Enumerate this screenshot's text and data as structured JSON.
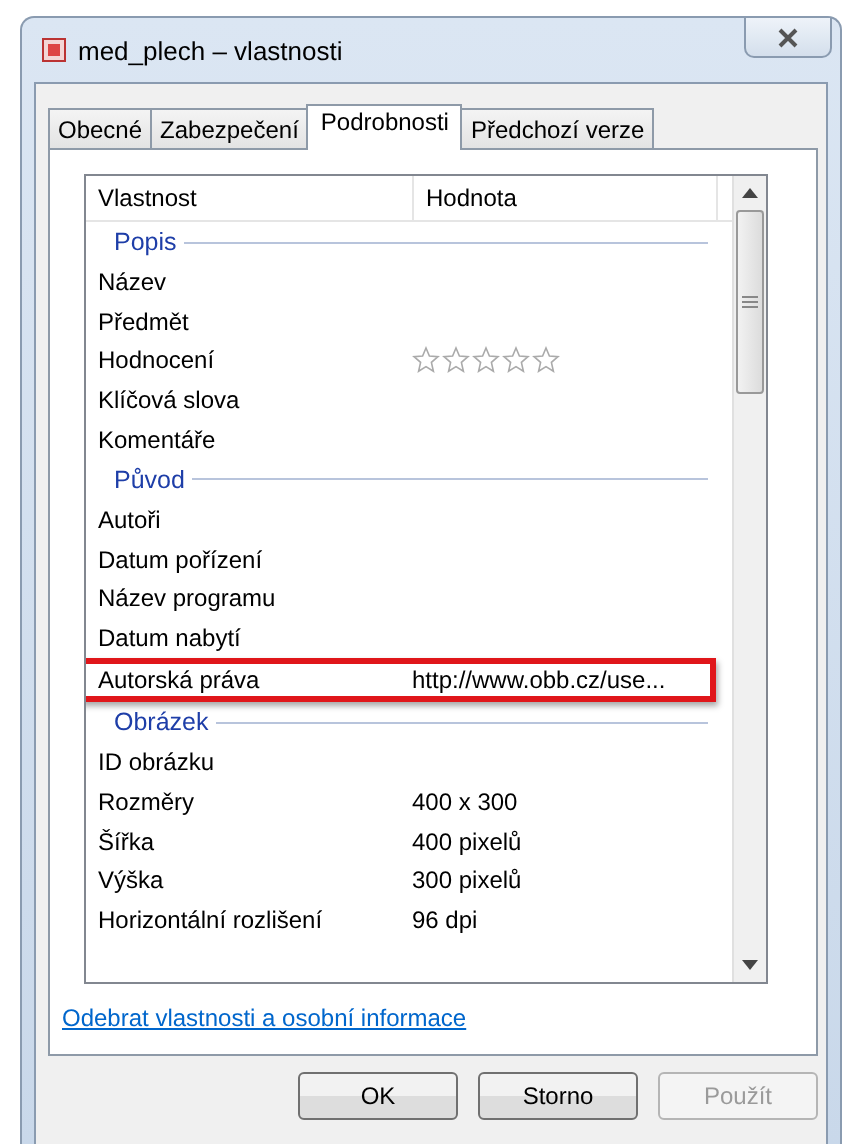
{
  "window": {
    "title": "med_plech – vlastnosti"
  },
  "tabs": [
    {
      "label": "Obecné",
      "selected": false
    },
    {
      "label": "Zabezpečení",
      "selected": false
    },
    {
      "label": "Podrobnosti",
      "selected": true
    },
    {
      "label": "Předchozí verze",
      "selected": false
    }
  ],
  "table": {
    "columns": [
      "Vlastnost",
      "Hodnota"
    ],
    "groups": [
      {
        "title": "Popis",
        "rows": [
          {
            "kind": "text",
            "name": "Název",
            "highlighted": false
          },
          {
            "kind": "text",
            "name": "Předmět",
            "highlighted": false
          },
          {
            "kind": "rating",
            "name": "Hodnocení",
            "stars": 0,
            "highlighted": false
          },
          {
            "kind": "text",
            "name": "Klíčová slova",
            "highlighted": false
          },
          {
            "kind": "text",
            "name": "Komentáře",
            "highlighted": false
          }
        ]
      },
      {
        "title": "Původ",
        "rows": [
          {
            "kind": "text",
            "name": "Autoři",
            "highlighted": false
          },
          {
            "kind": "text",
            "name": "Datum pořízení",
            "highlighted": false
          },
          {
            "kind": "text",
            "name": "Název programu",
            "highlighted": false
          },
          {
            "kind": "text",
            "name": "Datum nabytí",
            "highlighted": false
          },
          {
            "kind": "text",
            "name": "Autorská práva",
            "value": "http://www.obb.cz/use...",
            "highlighted": true
          }
        ]
      },
      {
        "title": "Obrázek",
        "rows": [
          {
            "kind": "text",
            "name": "ID obrázku",
            "highlighted": false
          },
          {
            "kind": "text",
            "name": "Rozměry",
            "value": "400 x 300",
            "highlighted": false
          },
          {
            "kind": "text",
            "name": "Šířka",
            "value": "400 pixelů",
            "highlighted": false
          },
          {
            "kind": "text",
            "name": "Výška",
            "value": "300 pixelů",
            "highlighted": false
          },
          {
            "kind": "text",
            "name": "Horizontální rozlišení",
            "value": "96 dpi",
            "highlighted": false
          }
        ]
      }
    ]
  },
  "link": "Odebrat vlastnosti a osobní informace",
  "buttons": [
    {
      "label": "OK",
      "disabled": false
    },
    {
      "label": "Storno",
      "disabled": false
    },
    {
      "label": "Použít",
      "disabled": true
    }
  ]
}
